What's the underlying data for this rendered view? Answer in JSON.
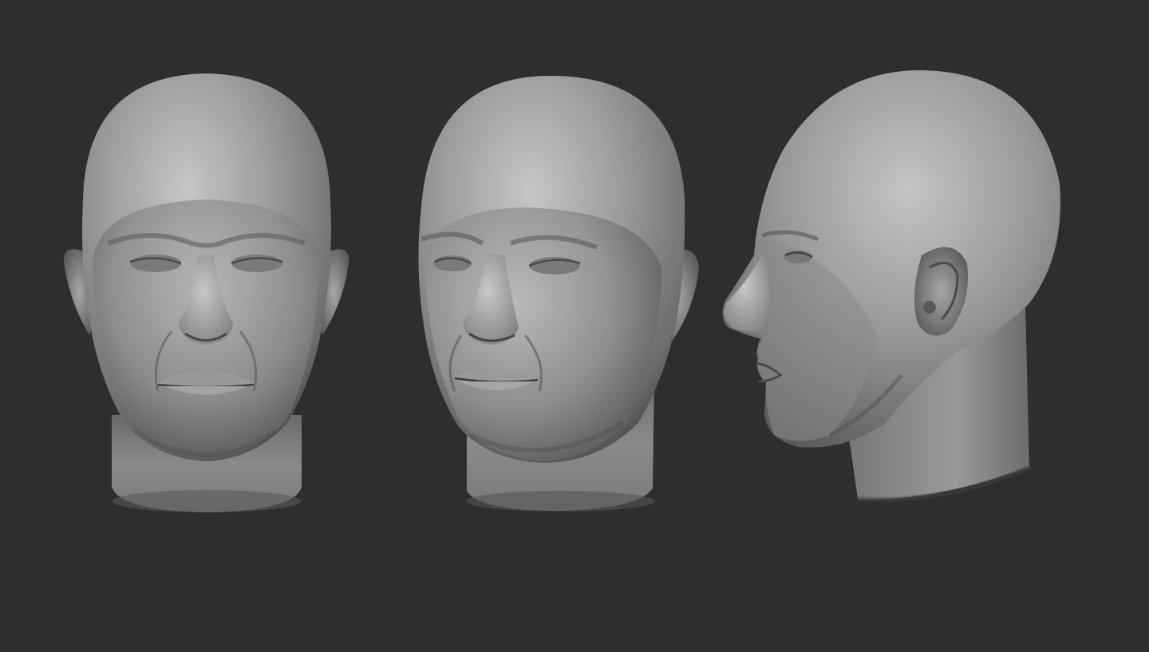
{
  "viewport": {
    "background_color": "#2e2e2e"
  },
  "scene": {
    "material_base_color": "#8c8c8c",
    "material_highlight_color": "#c4c4c4",
    "material_shadow_color": "#3a3a3a",
    "models": [
      {
        "view": "front",
        "icon": "head-front-view"
      },
      {
        "view": "three-quarter",
        "icon": "head-three-quarter-view"
      },
      {
        "view": "side",
        "icon": "head-side-view"
      }
    ]
  }
}
